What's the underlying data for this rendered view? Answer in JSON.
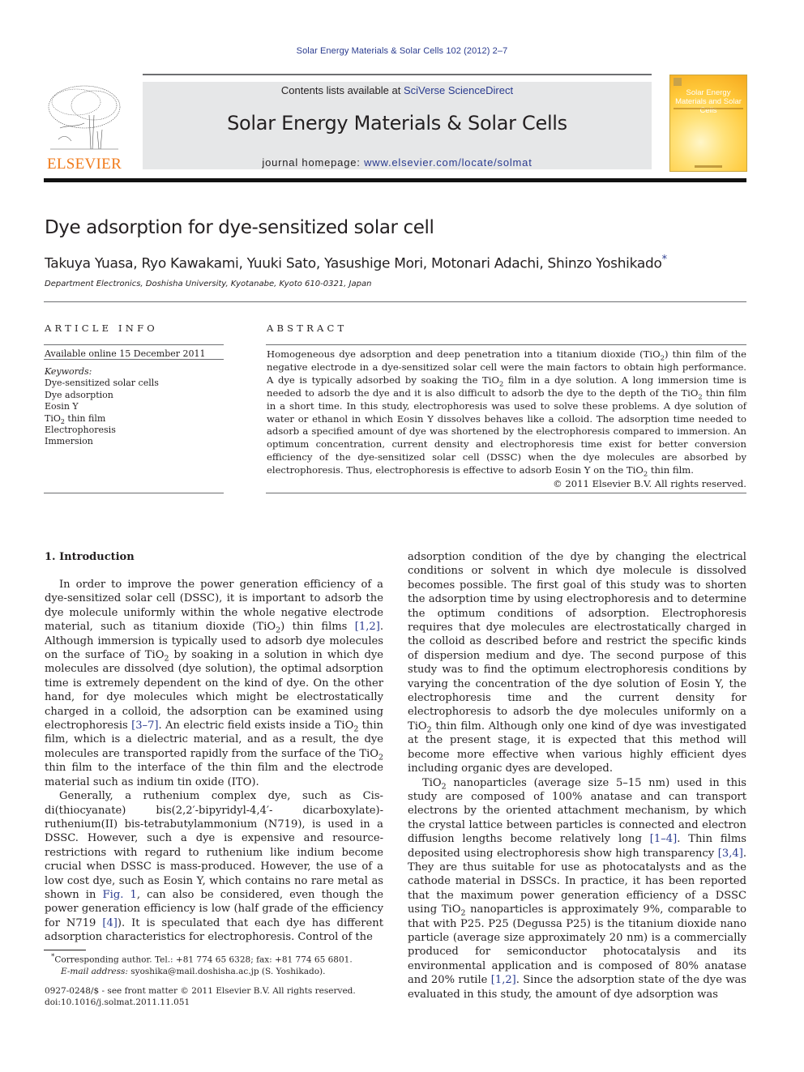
{
  "header": {
    "journal_ref": "Solar Energy Materials & Solar Cells 102 (2012) 2–7",
    "contents_prefix": "Contents lists available at ",
    "contents_link": "SciVerse ScienceDirect",
    "journal_name": "Solar Energy Materials & Solar Cells",
    "homepage_prefix": "journal homepage: ",
    "homepage_link": "www.elsevier.com/locate/solmat",
    "publisher_logo_text": "ELSEVIER",
    "cover_title": "Solar Energy Materials and Solar Cells",
    "icons": {
      "publisher_logo": "elsevier-tree-logo",
      "cover": "journal-cover-thumbnail"
    },
    "colors": {
      "link": "#2a3b8f",
      "publisher_orange": "#f07a1a",
      "masthead_bg": "#e6e7e8"
    }
  },
  "article": {
    "title": "Dye adsorption for dye-sensitized solar cell",
    "authors": "Takuya Yuasa, Ryo Kawakami, Yuuki Sato, Yasushige Mori, Motonari Adachi, Shinzo Yoshikado",
    "corresponding_mark": "*",
    "affiliation": "Department Electronics, Doshisha University, Kyotanabe, Kyoto 610-0321, Japan"
  },
  "article_info": {
    "heading": "ARTICLE INFO",
    "available_online": "Available online 15 December 2011",
    "keywords_label": "Keywords:",
    "keywords": [
      "Dye-sensitized solar cells",
      "Dye adsorption",
      "Eosin Y",
      "TiO2 thin film",
      "Electrophoresis",
      "Immersion"
    ]
  },
  "abstract": {
    "heading": "ABSTRACT",
    "text_parts": [
      "Homogeneous dye adsorption and deep penetration into a titanium dioxide (TiO",
      "2",
      ") thin film of the negative electrode in a dye-sensitized solar cell were the main factors to obtain high performance. A dye is typically adsorbed by soaking the TiO",
      "2",
      " film in a dye solution. A long immersion time is needed to adsorb the dye and it is also difficult to adsorb the dye to the depth of the TiO",
      "2",
      " thin film in a short time. In this study, electrophoresis was used to solve these problems. A dye solution of water or ethanol in which Eosin Y dissolves behaves like a colloid. The adsorption time needed to adsorb a specified amount of dye was shortened by the electrophoresis compared to immersion. An optimum concentration, current density and electrophoresis time exist for better conversion efficiency of the dye-sensitized solar cell (DSSC) when the dye molecules are absorbed by electrophoresis. Thus, electrophoresis is effective to adsorb Eosin Y on the TiO",
      "2",
      " thin film."
    ],
    "copyright": "© 2011 Elsevier B.V. All rights reserved."
  },
  "body": {
    "section_heading": "1.  Introduction",
    "left": {
      "p1": [
        "In order to improve the power generation efficiency of a dye-sensitized solar cell (DSSC), it is important to adsorb the dye molecule uniformly within the whole negative electrode material, such as titanium dioxide (TiO",
        "2",
        ") thin films ",
        "[1,2]",
        ". Although immersion is typically used to adsorb dye molecules on the surface of TiO",
        "2",
        " by soaking in a solution in which dye molecules are dissolved (dye solution), the optimal adsorption time is extremely dependent on the kind of dye. On the other hand, for dye molecules which might be electrostatically charged in a colloid, the adsorption can be examined using electrophoresis ",
        "[3–7]",
        ". An electric field exists inside a TiO",
        "2",
        " thin film, which is a dielectric material, and as a result, the dye molecules are transported rapidly from the surface of the TiO",
        "2",
        " thin film to the interface of the thin film and the electrode material such as indium tin oxide (ITO)."
      ],
      "p2": [
        "Generally, a ruthenium complex dye, such as Cis-di(thiocyanate) bis(2,2′-bipyridyl-4,4′- dicarboxylate)-ruthenium(II) bis-tetrabutylammonium (N719), is used in a DSSC. However, such a dye is expensive and resource-restrictions with regard to ruthenium like indium become crucial when DSSC is mass-produced. However, the use of a low cost dye, such as Eosin Y, which contains no rare metal as shown in ",
        "Fig. 1",
        ", can also be considered, even though the power generation efficiency is low (half grade of the efficiency for N719 ",
        "[4]",
        "). It is speculated that each dye has different adsorption characteristics for electrophoresis. Control of the"
      ]
    },
    "right": {
      "p1": "adsorption condition of the dye by changing the electrical conditions or solvent in which dye molecule is dissolved becomes possible. The first goal of this study was to shorten the adsorption time by using electrophoresis and to determine the optimum conditions of adsorption. Electrophoresis requires that dye molecules are electrostatically charged in the colloid as described before and restrict the specific kinds of dispersion medium and dye. The second purpose of this study was to find the optimum electrophoresis conditions by varying the concentration of the dye solution of Eosin Y, the electrophoresis time and the current density for electrophoresis to adsorb the dye molecules uniformly on a TiO",
      "p1_sub": "2",
      "p1_end": " thin film. Although only one kind of dye was investigated at the present stage, it is expected that this method will become more effective when various highly efficient dyes including organic dyes are developed.",
      "p2": [
        "TiO",
        "2",
        " nanoparticles (average size 5–15 nm) used in this study are composed of 100% anatase and can transport electrons by the oriented attachment mechanism, by which the crystal lattice between particles is connected and electron diffusion lengths become relatively long ",
        "[1–4]",
        ". Thin films deposited using electrophoresis show high transparency ",
        "[3,4]",
        ". They are thus suitable for use as photocatalysts and as the cathode material in DSSCs. In practice, it has been reported that the maximum power generation efficiency of a DSSC using TiO",
        "2",
        " nanoparticles is approximately 9%, comparable to that with P25. P25 (Degussa P25) is the titanium dioxide nano particle (average size approximately 20 nm) is a commercially produced for semiconductor photocatalysis and its environmental application and is composed of 80% anatase and 20% rutile ",
        "[1,2]",
        ". Since the adsorption state of the dye was evaluated in this study, the amount of dye adsorption was"
      ]
    }
  },
  "footnote": {
    "mark": "*",
    "line1": "Corresponding author. Tel.: +81 774 65 6328; fax: +81 774 65 6801.",
    "email_label": "E-mail address:",
    "email": " syoshika@mail.doshisha.ac.jp (S. Yoshikado)."
  },
  "front_matter": {
    "issn_line": "0927-0248/$ - see front matter © 2011 Elsevier B.V. All rights reserved.",
    "doi": "doi:10.1016/j.solmat.2011.11.051"
  }
}
